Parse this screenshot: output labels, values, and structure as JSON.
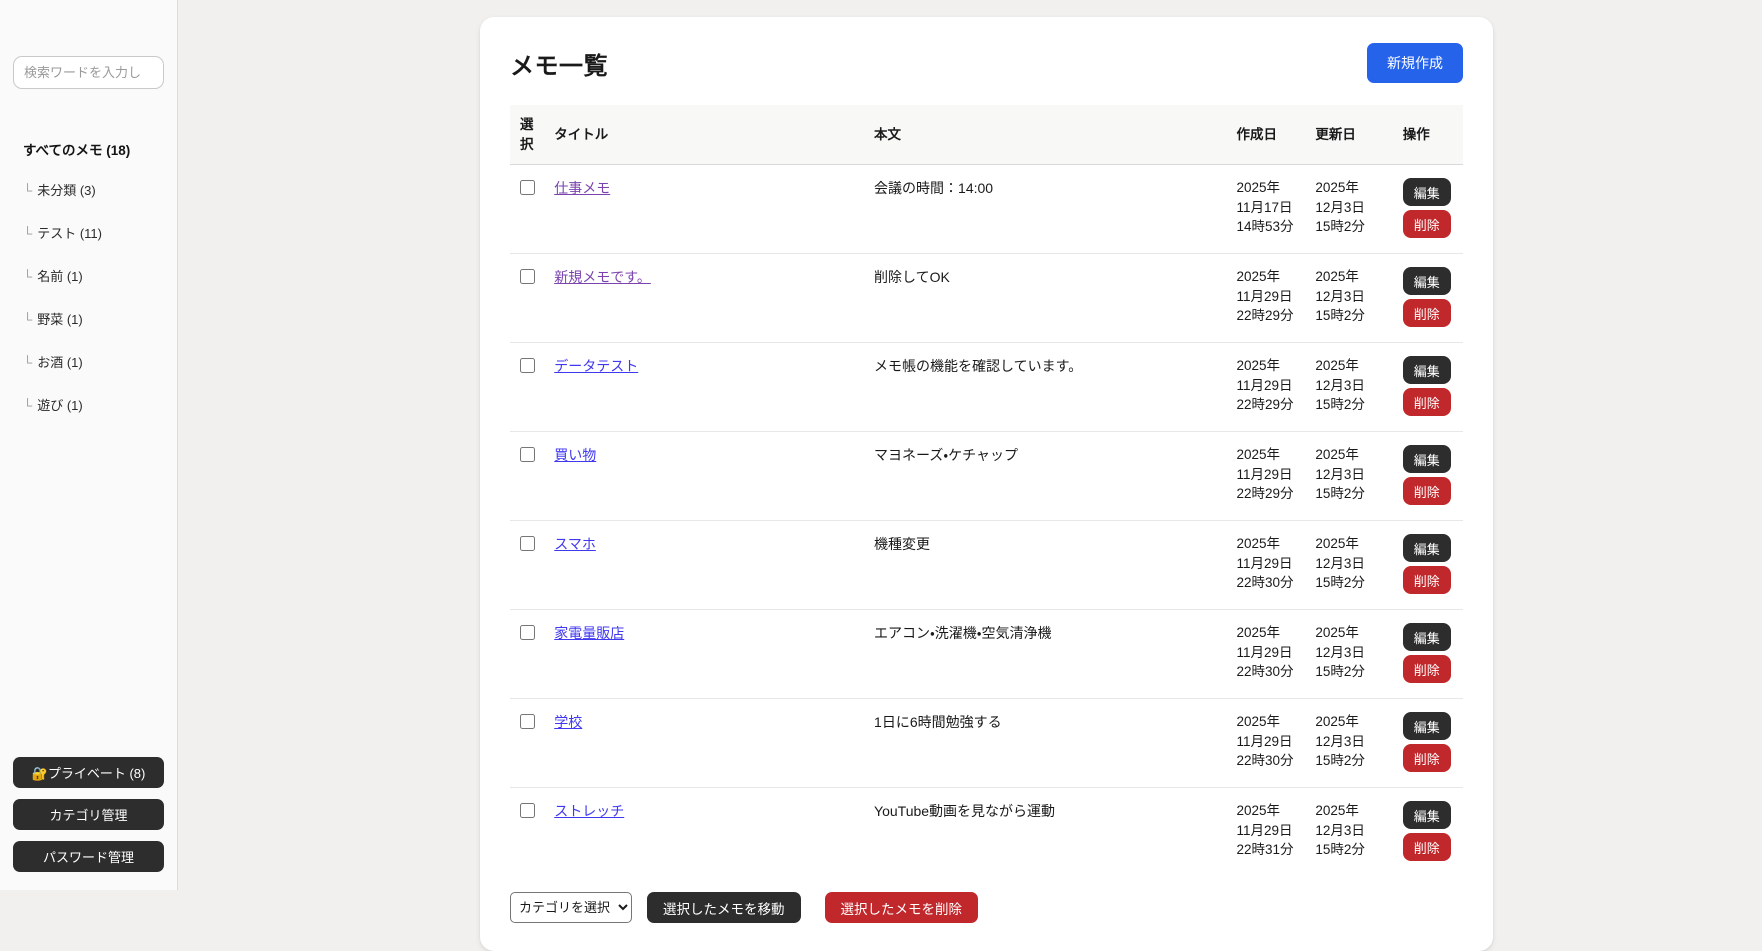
{
  "colors": {
    "accent": "#2563eb",
    "dark_button": "#2d2d2d",
    "danger": "#c0282c",
    "link": "#4038ef",
    "visited_link": "#7b43ad",
    "page_background": "#f1f0ee",
    "sidebar_background": "#fafafa"
  },
  "sidebar": {
    "search_placeholder": "検索ワードを入力し",
    "all_memos_label": "すべてのメモ (18)",
    "category_prefix": "└",
    "categories": [
      {
        "label": "未分類 (3)"
      },
      {
        "label": "テスト (11)"
      },
      {
        "label": "名前 (1)"
      },
      {
        "label": "野菜 (1)"
      },
      {
        "label": "お酒 (1)"
      },
      {
        "label": "遊び (1)"
      }
    ],
    "buttons": {
      "private_label": "🔐プライベート (8)",
      "category_manage_label": "カテゴリ管理",
      "password_manage_label": "パスワード管理"
    }
  },
  "main": {
    "title": "メモ一覧",
    "create_button": "新規作成",
    "table": {
      "headers": {
        "select": "選択",
        "title": "タイトル",
        "body": "本文",
        "created": "作成日",
        "updated": "更新日",
        "actions": "操作"
      },
      "edit_label": "編集",
      "delete_label": "削除",
      "rows": [
        {
          "title": "仕事メモ",
          "body": "会議の時間：14:00",
          "created": "2025年\n11月17日\n14時53分",
          "updated": "2025年\n12月3日\n15時2分",
          "visited": true,
          "checked": false
        },
        {
          "title": "新規メモです。",
          "body": "削除してOK",
          "created": "2025年\n11月29日\n22時29分",
          "updated": "2025年\n12月3日\n15時2分",
          "visited": true,
          "checked": false
        },
        {
          "title": "データテスト",
          "body": "メモ帳の機能を確認しています。",
          "created": "2025年\n11月29日\n22時29分",
          "updated": "2025年\n12月3日\n15時2分",
          "visited": false,
          "checked": false
        },
        {
          "title": "買い物",
          "body": "マヨネーズ・ケチャップ",
          "created": "2025年\n11月29日\n22時29分",
          "updated": "2025年\n12月3日\n15時2分",
          "visited": false,
          "checked": false
        },
        {
          "title": "スマホ",
          "body": "機種変更",
          "created": "2025年\n11月29日\n22時30分",
          "updated": "2025年\n12月3日\n15時2分",
          "visited": false,
          "checked": false
        },
        {
          "title": "家電量販店",
          "body": "エアコン・洗濯機・空気清浄機",
          "created": "2025年\n11月29日\n22時30分",
          "updated": "2025年\n12月3日\n15時2分",
          "visited": false,
          "checked": false
        },
        {
          "title": "学校",
          "body": "1日に6時間勉強する",
          "created": "2025年\n11月29日\n22時30分",
          "updated": "2025年\n12月3日\n15時2分",
          "visited": false,
          "checked": false
        },
        {
          "title": "ストレッチ",
          "body": "YouTube動画を見ながら運動",
          "created": "2025年\n11月29日\n22時31分",
          "updated": "2025年\n12月3日\n15時2分",
          "visited": false,
          "checked": false
        }
      ]
    },
    "footer": {
      "category_select_value": "カテゴリを選択",
      "move_button": "選択したメモを移動",
      "delete_button": "選択したメモを削除"
    }
  }
}
